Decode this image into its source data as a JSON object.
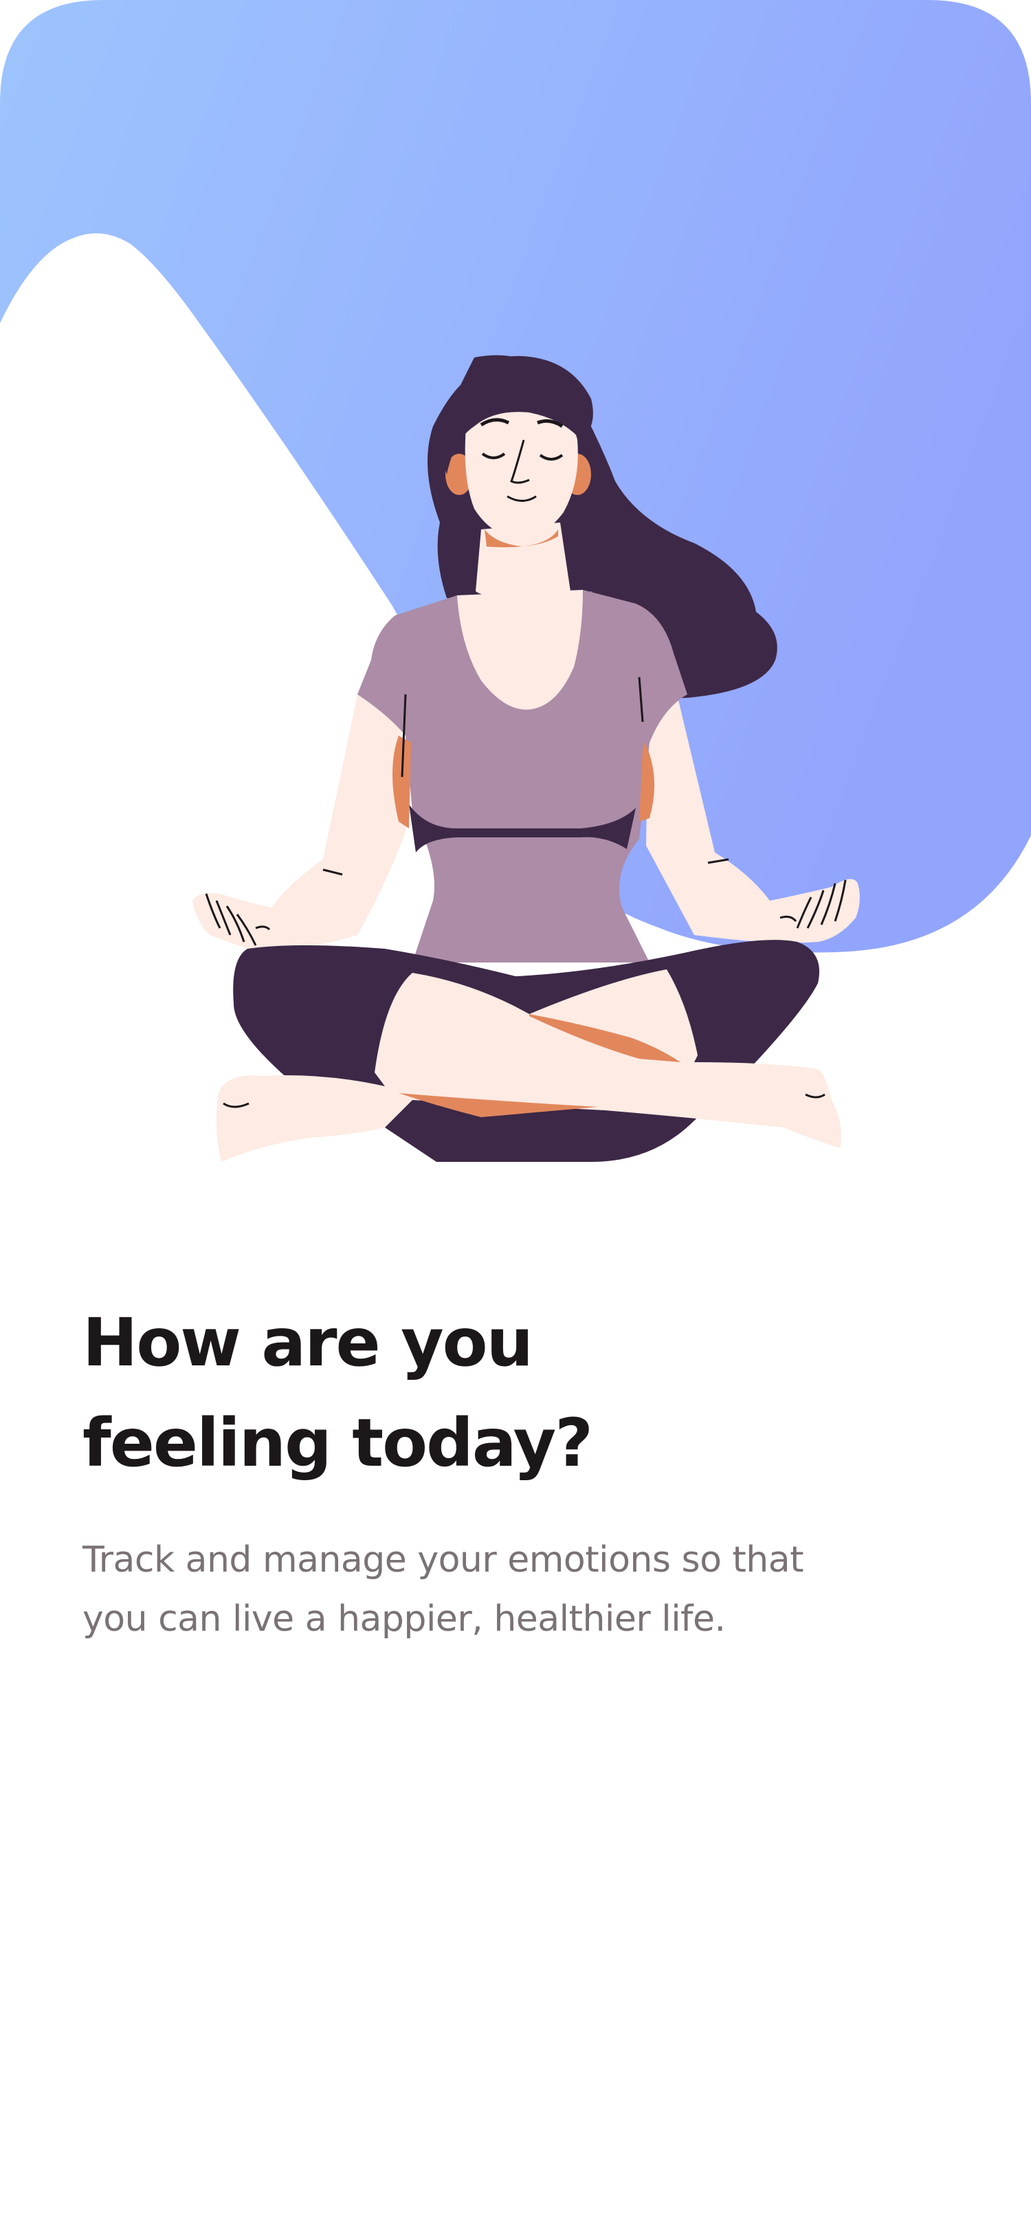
{
  "onboarding": {
    "title_line_1": "How are you",
    "title_line_2": "feeling today?",
    "subtitle_line_1": "Track and manage your emotions so that",
    "subtitle_line_2": "you can live a happier, healthier life."
  },
  "illustration": {
    "name": "meditating-woman",
    "background_gradient": [
      "#9dc4fd",
      "#92a5fd"
    ],
    "hair_color": "#3d2847",
    "shirt_color": "#ac8ca7",
    "skin_color": "#fdebe4",
    "accent_skin_color": "#e2875c",
    "pants_color": "#3d2847"
  }
}
